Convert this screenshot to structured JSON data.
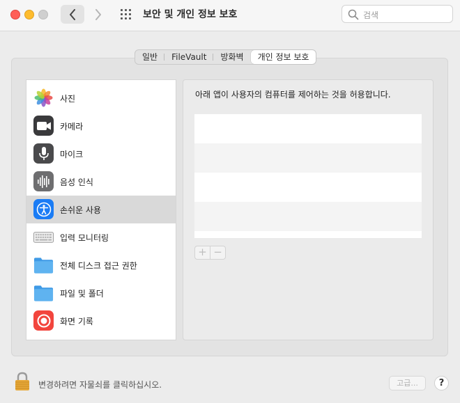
{
  "window": {
    "title": "보안 및 개인 정보 보호",
    "search_placeholder": "검색"
  },
  "tabs": [
    {
      "label": "일반",
      "active": false
    },
    {
      "label": "FileVault",
      "active": false
    },
    {
      "label": "방화벽",
      "active": false
    },
    {
      "label": "개인 정보 보호",
      "active": true
    }
  ],
  "sidebar": {
    "items": [
      {
        "label": "사진",
        "icon": "photos-icon"
      },
      {
        "label": "카메라",
        "icon": "camera-icon"
      },
      {
        "label": "마이크",
        "icon": "microphone-icon"
      },
      {
        "label": "음성 인식",
        "icon": "speech-recognition-icon"
      },
      {
        "label": "손쉬운 사용",
        "icon": "accessibility-icon",
        "selected": true
      },
      {
        "label": "입력 모니터링",
        "icon": "keyboard-icon"
      },
      {
        "label": "전체 디스크 접근 권한",
        "icon": "folder-icon"
      },
      {
        "label": "파일 및 폴더",
        "icon": "folder-icon"
      },
      {
        "label": "화면 기록",
        "icon": "screen-recording-icon"
      }
    ]
  },
  "main": {
    "description": "아래 앱이 사용자의 컴퓨터를 제어하는 것을 허용합니다.",
    "add_label": "+",
    "remove_label": "−"
  },
  "footer": {
    "lock_text": "변경하려면 자물쇠를 클릭하십시오.",
    "advanced_label": "고급...",
    "help_label": "?"
  },
  "colors": {
    "selection": "#d9d9d9",
    "accessibility_blue": "#1a7cf5",
    "folder_blue": "#5fb3f0",
    "record_red": "#f2453d"
  }
}
